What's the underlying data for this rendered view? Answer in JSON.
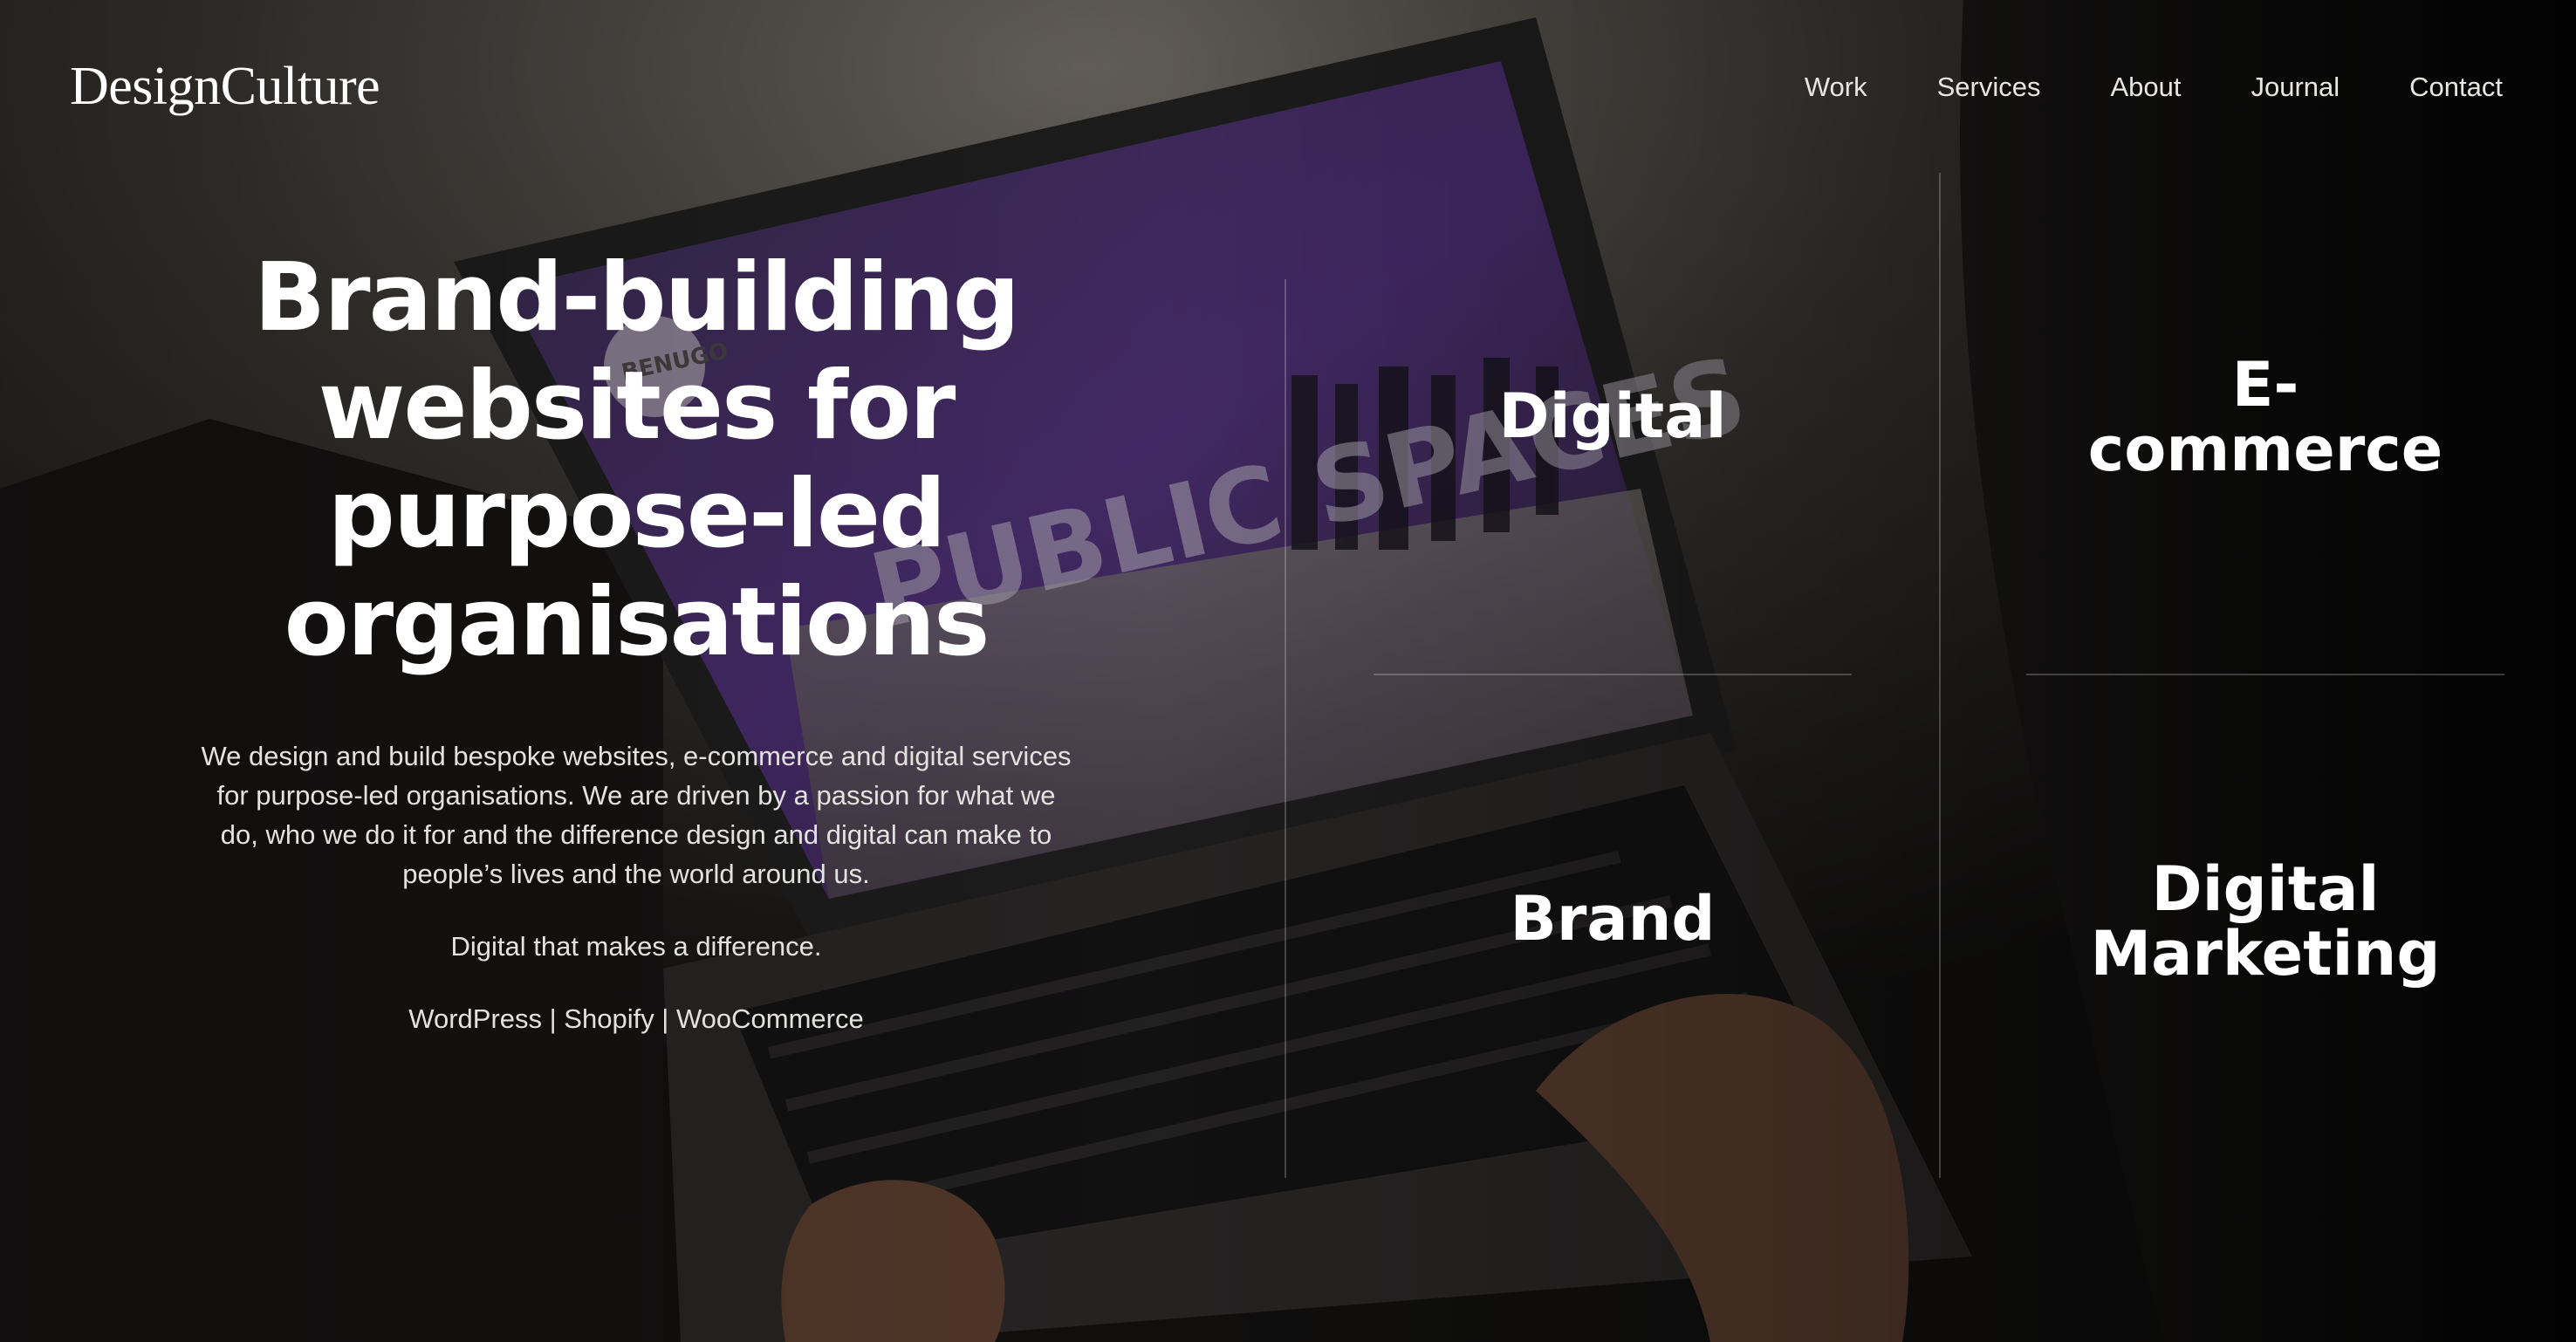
{
  "header": {
    "logo": "DesignCulture",
    "nav": [
      "Work",
      "Services",
      "About",
      "Journal",
      "Contact"
    ]
  },
  "hero": {
    "headline_lines": [
      "Brand-building",
      "websites for",
      "purpose-led",
      "organisations"
    ],
    "intro": "We design and build bespoke websites, e-commerce and digital services for purpose-led organisations. We are driven by a passion for what we do, who we do it for and the difference design and digital can make to people’s lives and the world around us.",
    "tagline": "Digital that makes a difference.",
    "tech": "WordPress | Shopify | WooCommerce"
  },
  "services": {
    "digital": "Digital",
    "ecommerce_line1": "E-",
    "ecommerce_line2": "commerce",
    "brand": "Brand",
    "marketing_line1": "Digital",
    "marketing_line2": "Marketing"
  },
  "background_photo": {
    "laptop_screen_text": "PUBLIC SPACES",
    "laptop_badge": "BENUGO"
  },
  "colors": {
    "text": "#ffffff",
    "nav_text": "#e8e6e3",
    "body_text": "#e4e2df",
    "accent_purple": "#5b3a8c"
  }
}
